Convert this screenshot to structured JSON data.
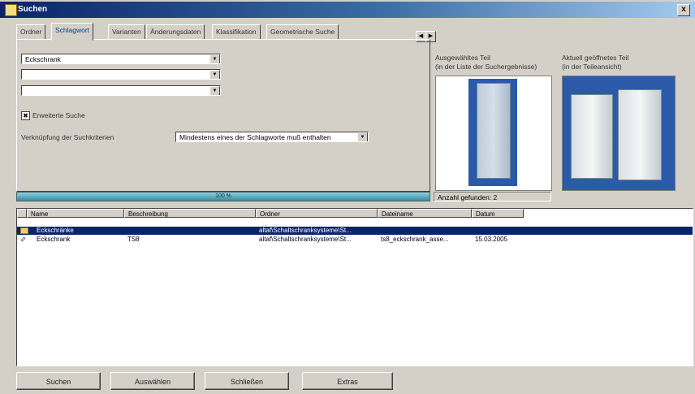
{
  "window": {
    "title": "Suchen",
    "close_label": "x"
  },
  "tabs": [
    {
      "label": "Ordner"
    },
    {
      "label": "Schlagwort"
    },
    {
      "label": "Varianten"
    },
    {
      "label": "Änderungsdaten"
    },
    {
      "label": "Klassifikation"
    },
    {
      "label": "Geometrische Suche"
    }
  ],
  "search": {
    "keyword_1": "Eckschrank",
    "keyword_2": "",
    "keyword_3": "",
    "extended_search_label": "Erweiterte Suche",
    "extended_search_checked": true,
    "link_label": "Verknüpfung der Suchkriterien",
    "link_value": "Mindestens eines der Schlagworte muß enthalten"
  },
  "progress": {
    "label": "100 %",
    "value_percent": 100
  },
  "preview": {
    "selected_caption_1": "Ausgewähltes Teil",
    "selected_caption_2": "(in der Liste der Suchergebnisse)",
    "open_caption_1": "Aktuell geöffnetes Teil",
    "open_caption_2": "(in der Teileansicht)"
  },
  "found_count": "Anzahl gefunden: 2",
  "list": {
    "columns": [
      "Name",
      "Beschreibung",
      "Ordner",
      "Dateiname",
      "Datum"
    ],
    "rows": [
      {
        "name": "Eckschränke",
        "desc": "",
        "folder": "altaf\\Schaltschranksysteme\\St...",
        "file": "",
        "date": "",
        "selected": true
      },
      {
        "name": "Eckschrank",
        "desc": "TS8",
        "folder": "altaf\\Schaltschranksysteme\\St...",
        "file": "ts8_eckschrank_asse...",
        "date": "15.03.2005",
        "selected": false
      }
    ]
  },
  "buttons": {
    "search": "Suchen",
    "select": "Auswählen",
    "close": "Schließen",
    "extras": "Extras"
  }
}
